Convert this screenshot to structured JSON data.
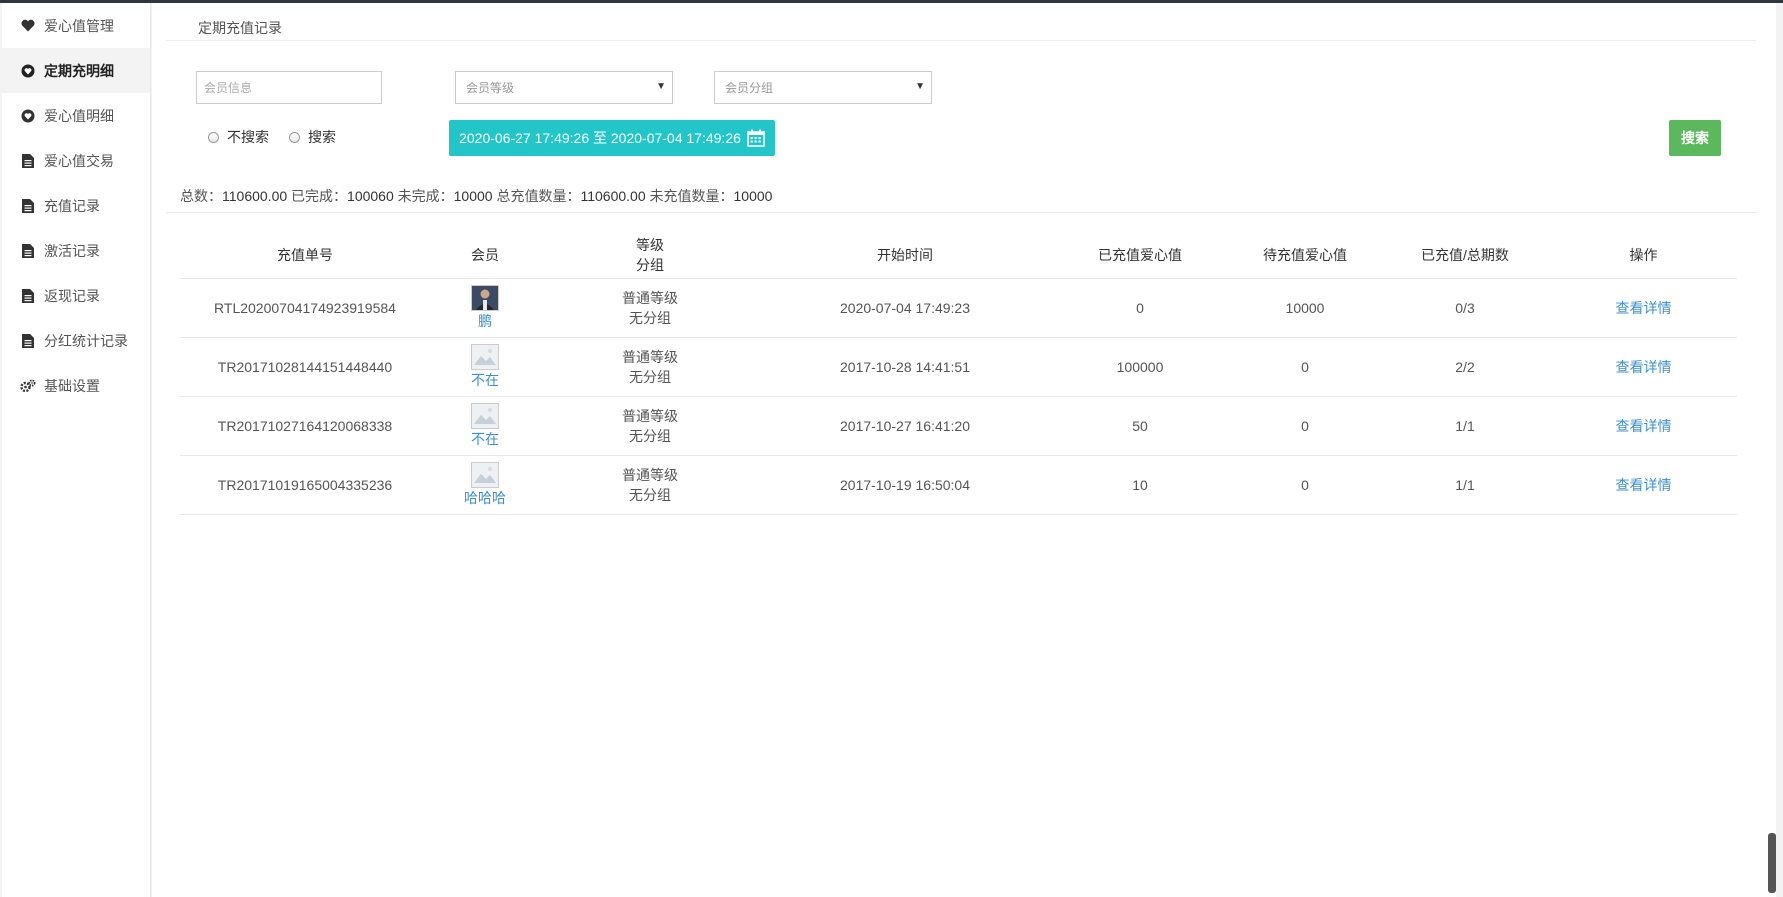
{
  "sidebar": {
    "items": [
      {
        "label": "爱心值管理",
        "icon": "heart-icon",
        "active": false
      },
      {
        "label": "定期充明细",
        "icon": "heart-circle-icon",
        "active": true
      },
      {
        "label": "爱心值明细",
        "icon": "heart-circle-icon",
        "active": false
      },
      {
        "label": "爱心值交易",
        "icon": "document-icon",
        "active": false
      },
      {
        "label": "充值记录",
        "icon": "document-icon",
        "active": false
      },
      {
        "label": "激活记录",
        "icon": "document-icon",
        "active": false
      },
      {
        "label": "返现记录",
        "icon": "document-icon",
        "active": false
      },
      {
        "label": "分红统计记录",
        "icon": "document-icon",
        "active": false
      },
      {
        "label": "基础设置",
        "icon": "gears-icon",
        "active": false
      }
    ]
  },
  "page": {
    "title": "定期充值记录"
  },
  "filters": {
    "member_info_placeholder": "会员信息",
    "member_level": "会员等级",
    "member_group": "会员分组",
    "radio_no_search": "不搜索",
    "radio_search": "搜索",
    "date_range": "2020-06-27 17:49:26 至 2020-07-04 17:49:26",
    "search_button": "搜索"
  },
  "summary": {
    "total_label": "总数：",
    "total_value": "110600.00",
    "done_label": "已完成：",
    "done_value": "100060",
    "undone_label": "未完成：",
    "undone_value": "10000",
    "recharged_count_label": "总充值数量：",
    "recharged_count_value": "110600.00",
    "unrecharged_count_label": "未充值数量：",
    "unrecharged_count_value": "10000"
  },
  "table": {
    "headers": {
      "order_no": "充值单号",
      "member": "会员",
      "level_line1": "等级",
      "level_line2": "分组",
      "start_time": "开始时间",
      "recharged": "已充值爱心值",
      "pending": "待充值爱心值",
      "periods": "已充值/总期数",
      "action": "操作"
    },
    "rows": [
      {
        "order_no": "RTL20200704174923919584",
        "member_name": "鹏",
        "avatar": "photo",
        "level": "普通等级",
        "group": "无分组",
        "start_time": "2020-07-04 17:49:23",
        "recharged": "0",
        "pending": "10000",
        "periods": "0/3",
        "action": "查看详情"
      },
      {
        "order_no": "TR20171028144151448440",
        "member_name": "不在",
        "avatar": "placeholder",
        "level": "普通等级",
        "group": "无分组",
        "start_time": "2017-10-28 14:41:51",
        "recharged": "100000",
        "pending": "0",
        "periods": "2/2",
        "action": "查看详情"
      },
      {
        "order_no": "TR20171027164120068338",
        "member_name": "不在",
        "avatar": "placeholder",
        "level": "普通等级",
        "group": "无分组",
        "start_time": "2017-10-27 16:41:20",
        "recharged": "50",
        "pending": "0",
        "periods": "1/1",
        "action": "查看详情"
      },
      {
        "order_no": "TR20171019165004335236",
        "member_name": "哈哈哈",
        "avatar": "placeholder",
        "level": "普通等级",
        "group": "无分组",
        "start_time": "2017-10-19 16:50:04",
        "recharged": "10",
        "pending": "0",
        "periods": "1/1",
        "action": "查看详情"
      }
    ]
  },
  "colors": {
    "date_button": "#23c6c8",
    "search_button": "#5cb85c",
    "link": "#3f8fd0"
  }
}
